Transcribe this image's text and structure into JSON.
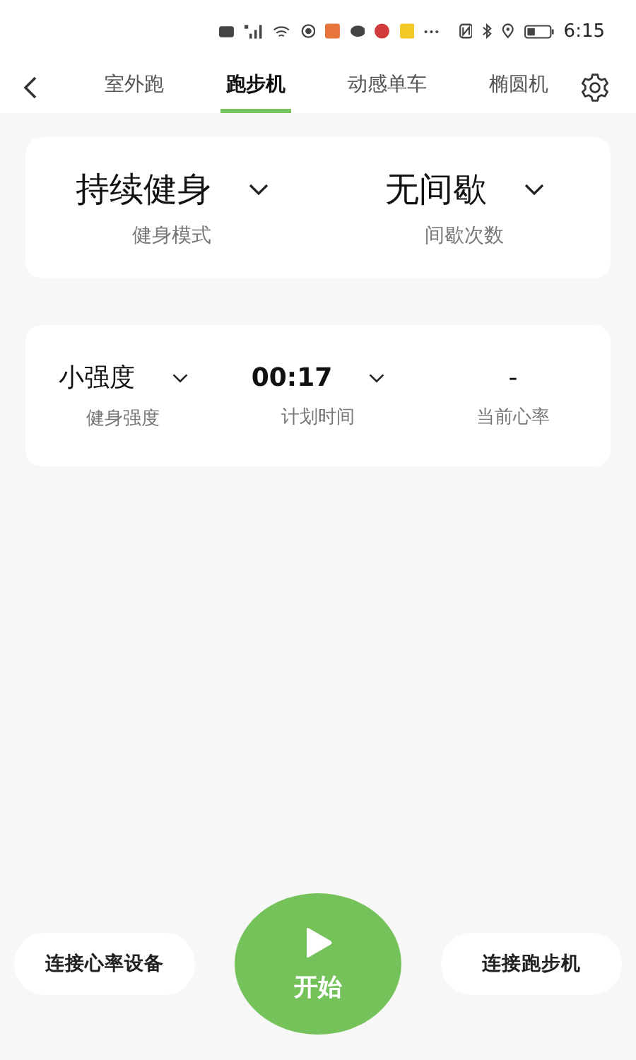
{
  "status_bar": {
    "time": "6:15"
  },
  "tabs": [
    {
      "label": "室外跑",
      "selected": false
    },
    {
      "label": "跑步机",
      "selected": true
    },
    {
      "label": "动感单车",
      "selected": false
    },
    {
      "label": "椭圆机",
      "selected": false
    }
  ],
  "mode_card": [
    {
      "value": "持续健身",
      "label": "健身模式",
      "dropdown": true
    },
    {
      "value": "无间歇",
      "label": "间歇次数",
      "dropdown": true
    }
  ],
  "stats_card": [
    {
      "value": "小强度",
      "label": "健身强度",
      "dropdown": true
    },
    {
      "value": "00:17",
      "label": "计划时间",
      "dropdown": true
    },
    {
      "value": "-",
      "label": "当前心率",
      "dropdown": false
    }
  ],
  "actions": {
    "left": "连接心率设备",
    "start": "开始",
    "right": "连接跑步机"
  }
}
